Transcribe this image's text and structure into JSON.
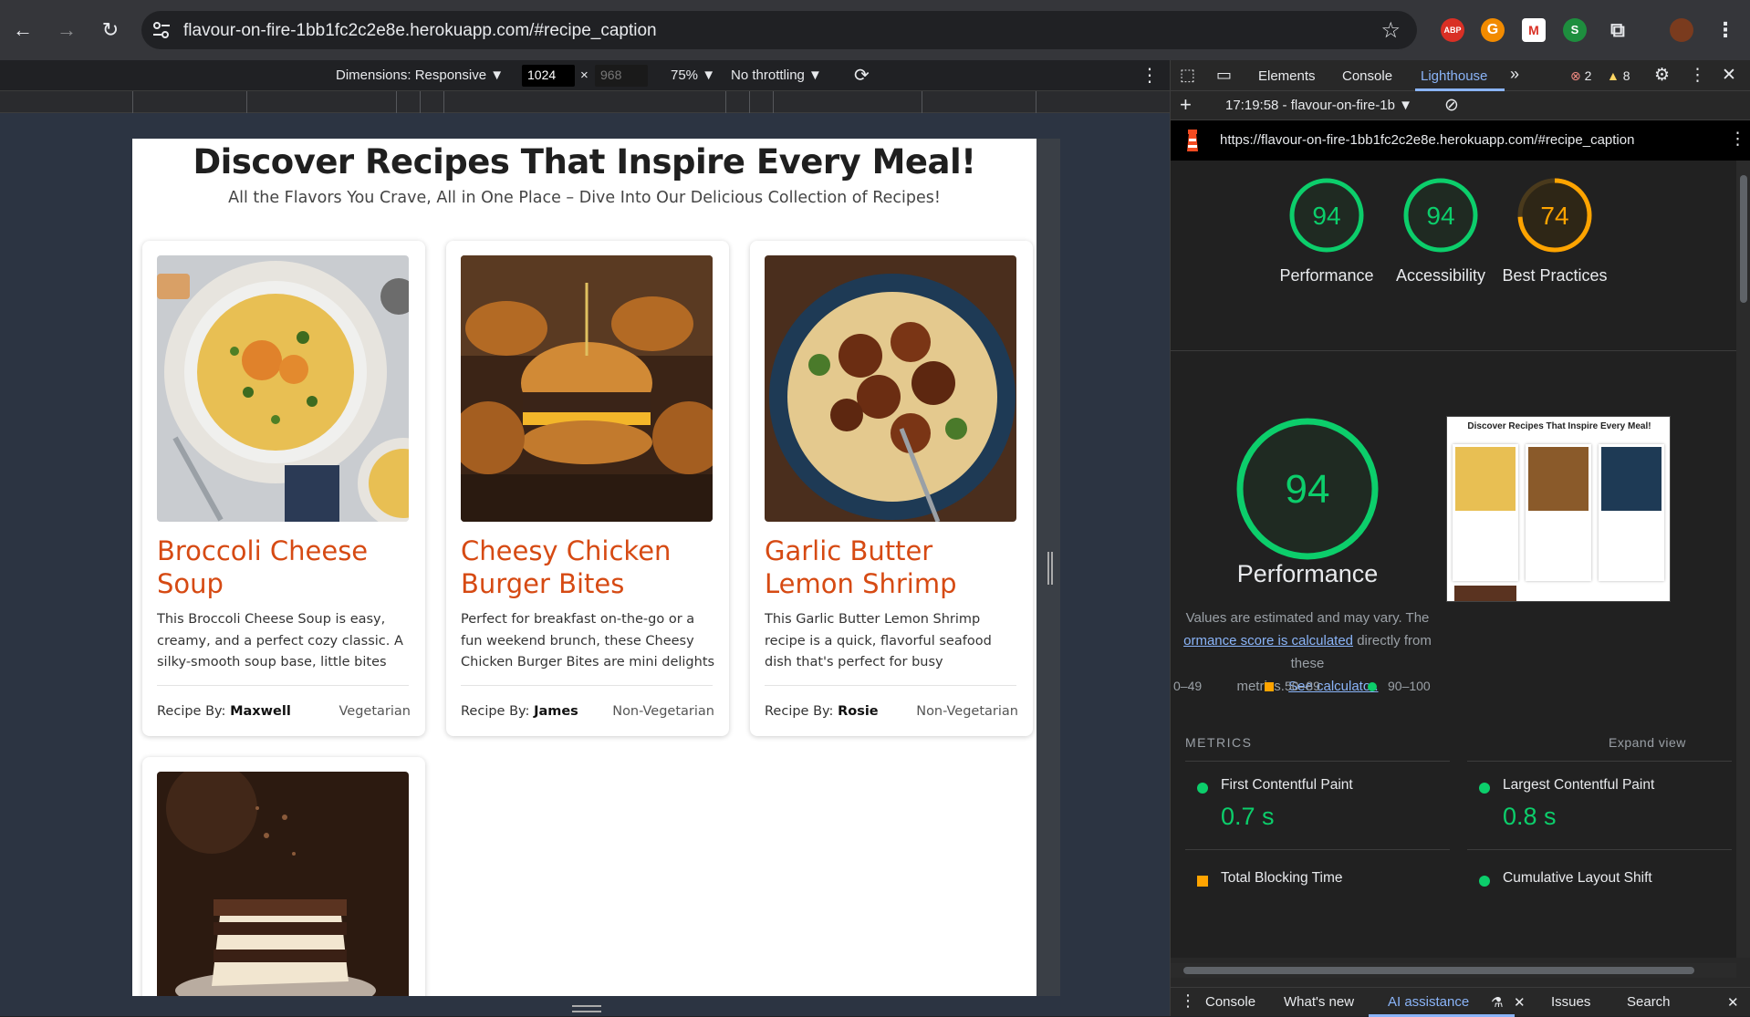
{
  "browser": {
    "url": "flavour-on-fire-1bb1fc2c2e8e.herokuapp.com/#recipe_caption",
    "extensions": [
      "ABP",
      "G",
      "M",
      "S",
      "puzzle",
      "avatar"
    ]
  },
  "device_toolbar": {
    "dimensions_label": "Dimensions: Responsive ▼",
    "width": "1024",
    "x": "×",
    "height": "968",
    "zoom": "75% ▼",
    "throttling": "No throttling ▼"
  },
  "page": {
    "title": "Discover Recipes That Inspire Every Meal!",
    "subtitle": "All the Flavors You Crave, All in One Place – Dive Into Our Delicious Collection of Recipes!",
    "recipe_by_label": "Recipe By: ",
    "cards": [
      {
        "title": "Broccoli Cheese Soup",
        "desc": "This Broccoli Cheese Soup is easy, creamy, and a perfect cozy classic. A silky-smooth soup base, little bites of...",
        "author": "Maxwell",
        "category": "Vegetarian"
      },
      {
        "title": "Cheesy Chicken Burger Bites",
        "desc": "Perfect for breakfast on-the-go or a fun weekend brunch, these Cheesy Chicken Burger Bites are mini delights packed...",
        "author": "James",
        "category": "Non-Vegetarian"
      },
      {
        "title": "Garlic Butter Lemon Shrimp",
        "desc": "This Garlic Butter Lemon Shrimp recipe is a quick, flavorful seafood dish that's perfect for busy weeknights or special...",
        "author": "Rosie",
        "category": "Non-Vegetarian"
      }
    ]
  },
  "devtools": {
    "tabs": [
      "Elements",
      "Console",
      "Lighthouse"
    ],
    "more": "»",
    "errors": "2",
    "warnings": "8",
    "report_selector": "17:19:58 - flavour-on-fire-1b ▼",
    "report_url": "https://flavour-on-fire-1bb1fc2c2e8e.herokuapp.com/#recipe_caption",
    "scores": [
      {
        "label": "Performance",
        "value": "94",
        "color": "#0cce6b"
      },
      {
        "label": "Accessibility",
        "value": "94",
        "color": "#0cce6b"
      },
      {
        "label": "Best Practices",
        "value": "74",
        "color": "#ffa400"
      }
    ],
    "big_score": {
      "value": "94",
      "label": "Performance"
    },
    "estimate_text_1": "Values are estimated and may vary. The",
    "estimate_link_1": "ormance score is calculated",
    "estimate_text_2": " directly from these",
    "estimate_text_3": "metrics. ",
    "estimate_link_2": "See calculator.",
    "legend": [
      "0–49",
      "50–89",
      "90–100"
    ],
    "thumbnail_title": "Discover Recipes That Inspire Every Meal!",
    "metrics_header": "METRICS",
    "expand_view": "Expand view",
    "metrics": [
      {
        "name": "First Contentful Paint",
        "value": "0.7 s",
        "status": "green"
      },
      {
        "name": "Largest Contentful Paint",
        "value": "0.8 s",
        "status": "green"
      },
      {
        "name": "Total Blocking Time",
        "value": "",
        "status": "orange"
      },
      {
        "name": "Cumulative Layout Shift",
        "value": "",
        "status": "green"
      }
    ],
    "drawer_tabs": [
      "Console",
      "What's new",
      "AI assistance",
      "Issues",
      "Search"
    ]
  }
}
